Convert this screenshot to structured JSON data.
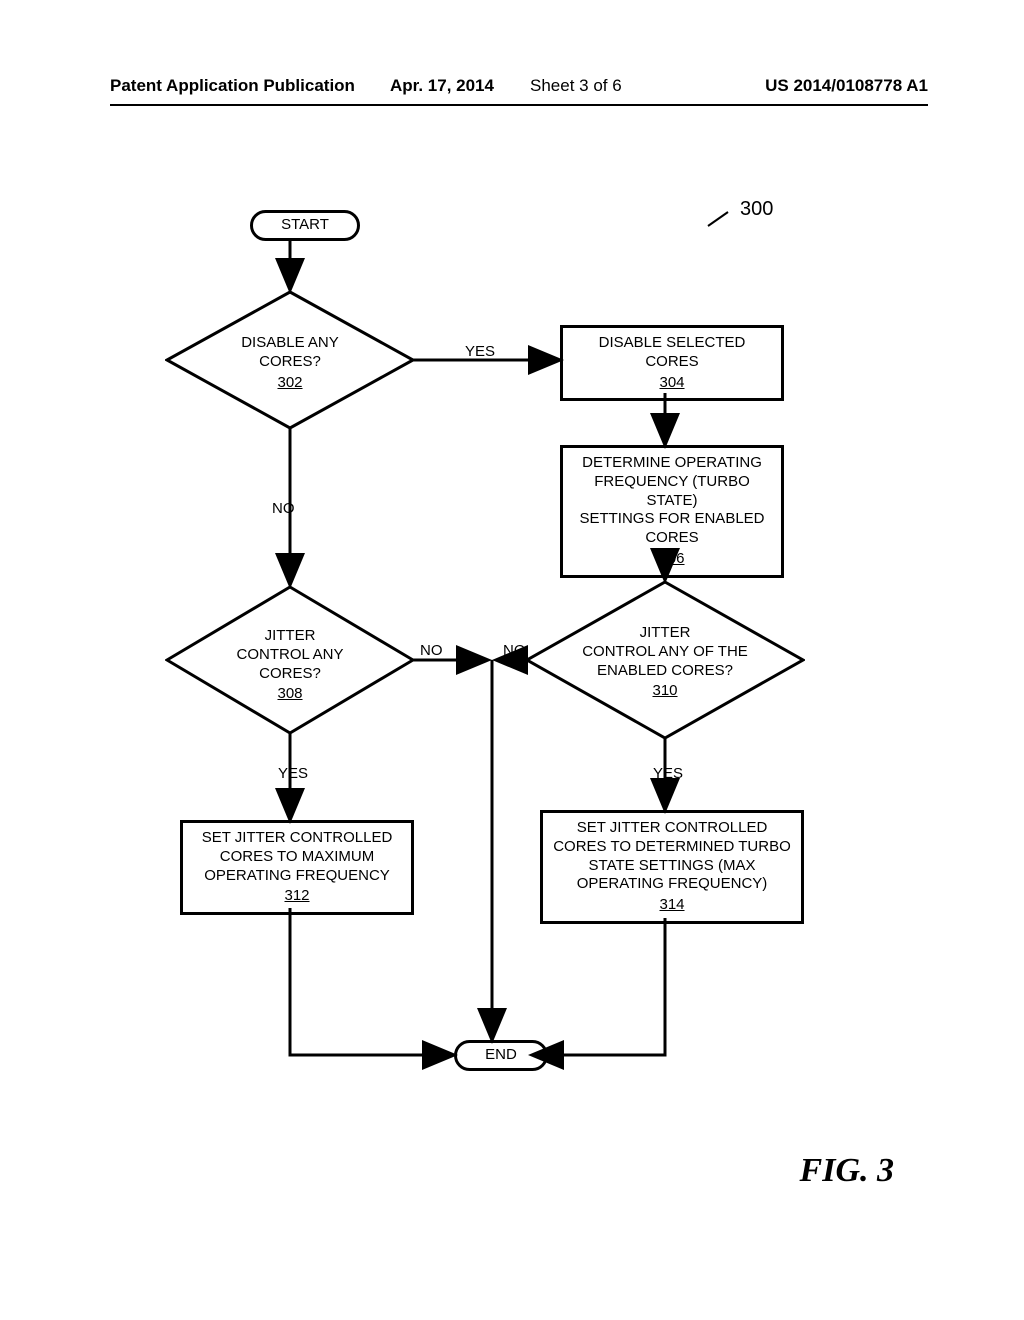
{
  "header": {
    "pub": "Patent Application Publication",
    "date": "Apr. 17, 2014",
    "sheet": "Sheet 3 of 6",
    "pubno": "US 2014/0108778 A1"
  },
  "figure_label": "FIG. 3",
  "ref300": "300",
  "nodes": {
    "start": "START",
    "end": "END",
    "d302": {
      "l1": "DISABLE ANY",
      "l2": "CORES?",
      "ref": "302"
    },
    "p304": {
      "l1": "DISABLE SELECTED",
      "l2": "CORES",
      "ref": "304"
    },
    "p306": {
      "l1": "DETERMINE OPERATING",
      "l2": "FREQUENCY (TURBO STATE)",
      "l3": "SETTINGS FOR ENABLED",
      "l4": "CORES",
      "ref": "306"
    },
    "d308": {
      "l1": "JITTER",
      "l2": "CONTROL ANY",
      "l3": "CORES?",
      "ref": "308"
    },
    "d310": {
      "l1": "JITTER",
      "l2": "CONTROL ANY OF THE",
      "l3": "ENABLED CORES?",
      "ref": "310"
    },
    "p312": {
      "l1": "SET JITTER CONTROLLED",
      "l2": "CORES TO MAXIMUM",
      "l3": "OPERATING FREQUENCY",
      "ref": "312"
    },
    "p314": {
      "l1": "SET JITTER CONTROLLED",
      "l2": "CORES TO DETERMINED TURBO",
      "l3": "STATE SETTINGS (MAX",
      "l4": "OPERATING FREQUENCY)",
      "ref": "314"
    }
  },
  "labels": {
    "yes": "YES",
    "no": "NO"
  }
}
